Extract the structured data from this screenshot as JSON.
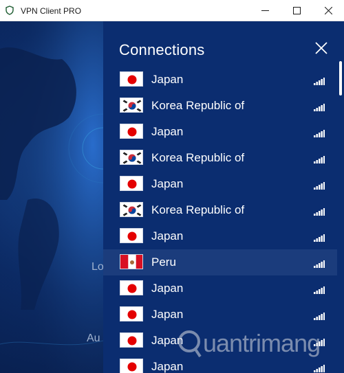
{
  "window": {
    "title": "VPN Client PRO"
  },
  "background": {
    "partial_text_1": "Lo",
    "partial_text_2": "Au"
  },
  "panel": {
    "title": "Connections",
    "close_icon": "close-icon"
  },
  "connections": [
    {
      "country": "Japan",
      "flag": "japan",
      "signal": "signal-bars-icon"
    },
    {
      "country": "Korea Republic of",
      "flag": "korea",
      "signal": "signal-bars-icon"
    },
    {
      "country": "Japan",
      "flag": "japan",
      "signal": "signal-bars-icon"
    },
    {
      "country": "Korea Republic of",
      "flag": "korea",
      "signal": "signal-bars-icon"
    },
    {
      "country": "Japan",
      "flag": "japan",
      "signal": "signal-bars-icon"
    },
    {
      "country": "Korea Republic of",
      "flag": "korea",
      "signal": "signal-bars-icon"
    },
    {
      "country": "Japan",
      "flag": "japan",
      "signal": "signal-bars-icon"
    },
    {
      "country": "Peru",
      "flag": "peru",
      "signal": "signal-bars-icon",
      "selected": true
    },
    {
      "country": "Japan",
      "flag": "japan",
      "signal": "signal-bars-icon"
    },
    {
      "country": "Japan",
      "flag": "japan",
      "signal": "signal-bars-icon"
    },
    {
      "country": "Japan",
      "flag": "japan",
      "signal": "signal-bars-icon"
    },
    {
      "country": "Japan",
      "flag": "japan",
      "signal": "signal-bars-icon"
    }
  ],
  "watermark": {
    "text": "uantrimang"
  },
  "colors": {
    "panel_bg": "#0b2d70",
    "selected_row_bg": "#1b3c7c",
    "text": "#ffffff"
  }
}
